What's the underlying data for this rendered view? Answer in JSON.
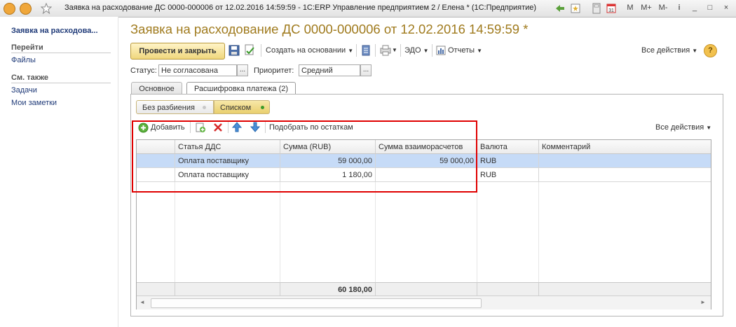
{
  "window": {
    "title": "Заявка на расходование ДС 0000-000006 от 12.02.2016 14:59:59 - 1С:ERP Управление предприятием 2 / Елена * (1С:Предприятие)",
    "memory_buttons": [
      "M",
      "M+",
      "M-"
    ]
  },
  "sidebar": {
    "title": "Заявка на расходова...",
    "goto_header": "Перейти",
    "goto_items": [
      "Файлы"
    ],
    "see_also_header": "См. также",
    "see_also_items": [
      "Задачи",
      "Мои заметки"
    ]
  },
  "form": {
    "title": "Заявка на расходование ДС 0000-000006 от 12.02.2016 14:59:59 *",
    "toolbar": {
      "post_and_close": "Провести и закрыть",
      "create_based_on": "Создать на основании",
      "edo": "ЭДО",
      "reports": "Отчеты",
      "all_actions": "Все действия",
      "help": "?"
    },
    "status_label": "Статус:",
    "status_value": "Не согласована",
    "priority_label": "Приоритет:",
    "priority_value": "Средний",
    "tabs": [
      "Основное",
      "Расшифровка платежа (2)"
    ],
    "active_tab": 1
  },
  "decryption": {
    "mode_options": [
      "Без разбиения",
      "Списком"
    ],
    "selected_mode": "Списком",
    "table_toolbar": {
      "add": "Добавить",
      "fill_by_balances": "Подобрать по остаткам",
      "all_actions": "Все действия"
    },
    "columns": [
      "Статья ДДС",
      "Сумма (RUB)",
      "Сумма взаиморасчетов",
      "Валюта",
      "Комментарий"
    ],
    "rows": [
      {
        "item": "Оплата поставщику",
        "amount": "59 000,00",
        "settlement_amount": "59 000,00",
        "currency": "RUB",
        "comment": ""
      },
      {
        "item": "Оплата поставщику",
        "amount": "1 180,00",
        "settlement_amount": "",
        "currency": "RUB",
        "comment": ""
      }
    ],
    "selected_row": 0,
    "total_amount": "60 180,00"
  },
  "colors": {
    "title_gold": "#a07b1e",
    "link_blue": "#1f3a78",
    "selected_row": "#c6dbf7",
    "annotation_red": "#e00000",
    "primary_button": "#f0d77c"
  }
}
